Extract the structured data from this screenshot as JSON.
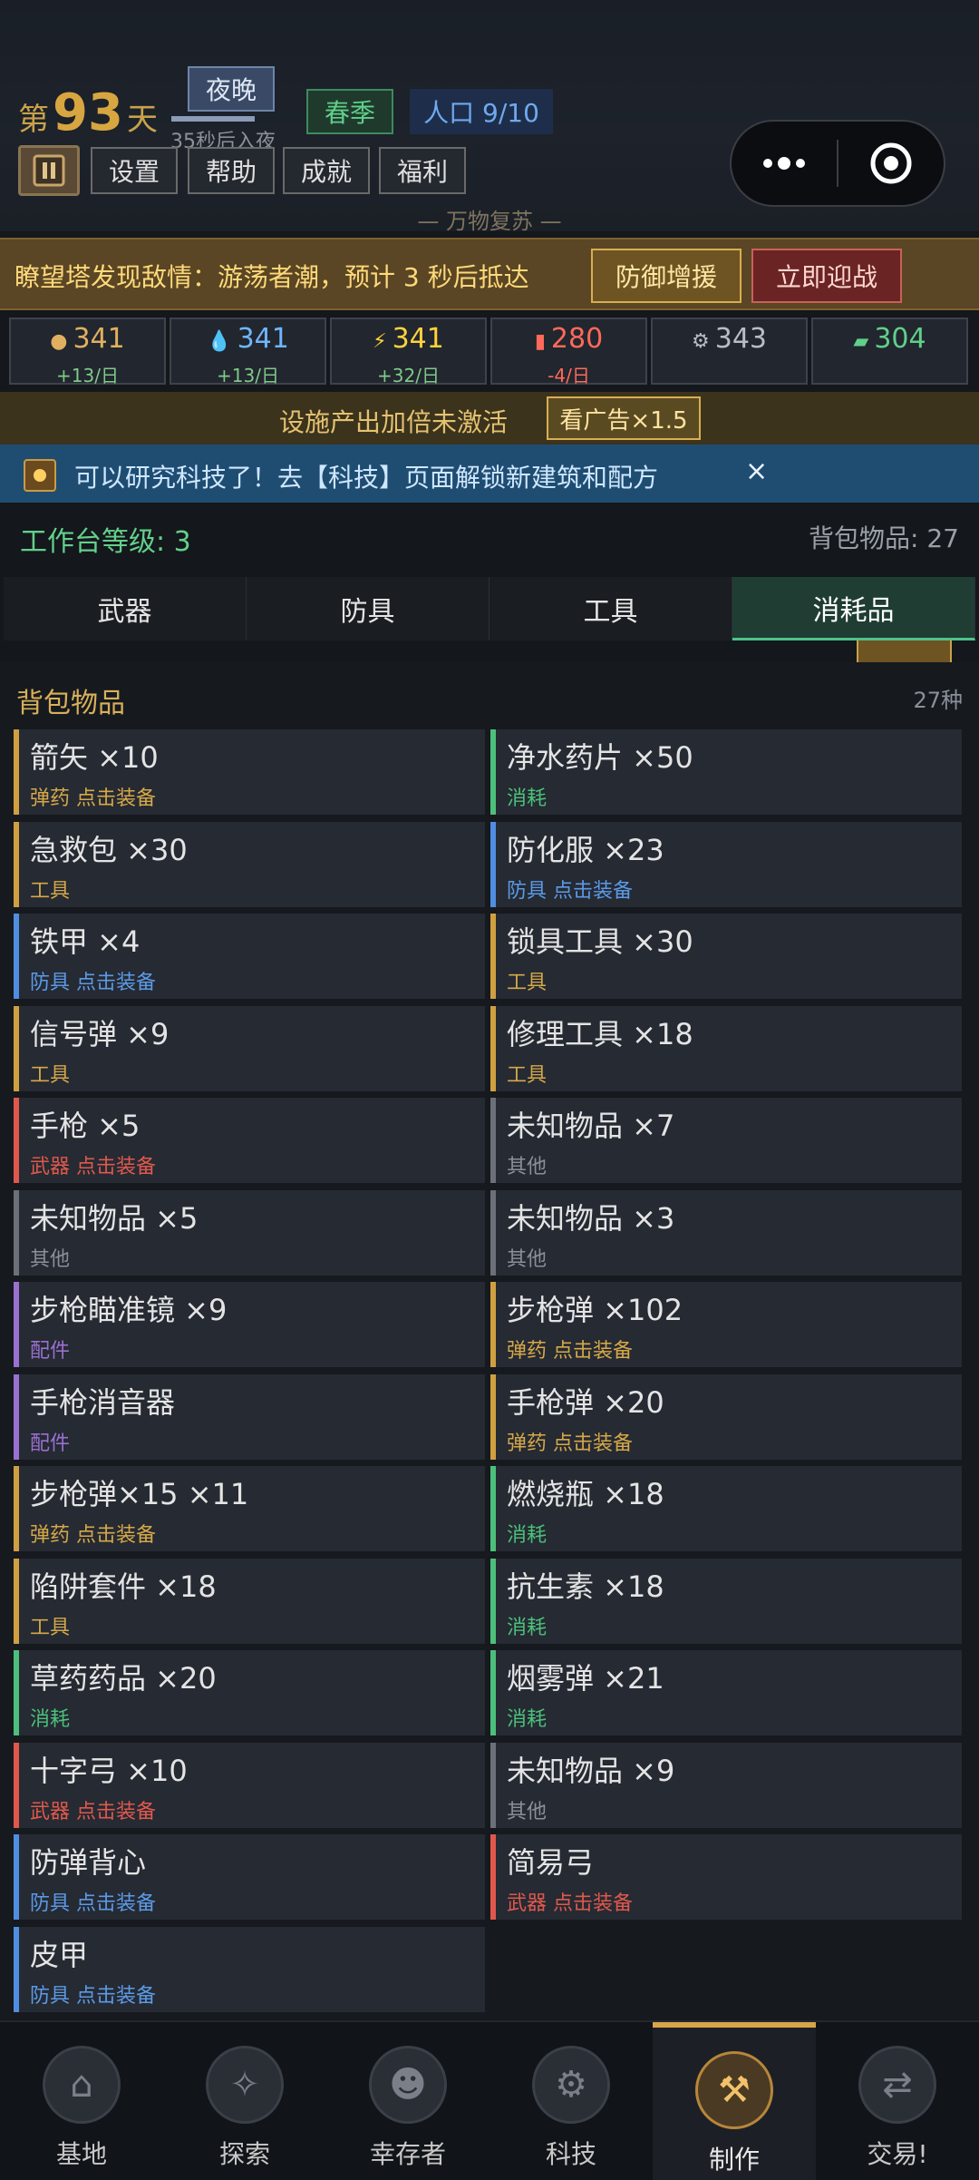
{
  "header": {
    "day_prefix": "第",
    "day_number": "93",
    "day_suffix": "天",
    "phase": "夜晚",
    "phase_sub": "35秒后入夜",
    "phase_progress": 0.75,
    "season": "春季",
    "population": "人口 9/10",
    "menu_buttons": [
      "设置",
      "帮助",
      "成就",
      "福利"
    ],
    "motto": "— 万物复苏 —"
  },
  "alert": {
    "text": "瞭望塔发现敌情：游荡者潮，预计 3 秒后抵达",
    "defend_label": "防御增援",
    "fight_label": "立即迎战"
  },
  "resources": [
    {
      "value": "341",
      "rate": "+13/日",
      "icon": "food-icon",
      "color": "#e0b060",
      "rate_color": "#7fc98a"
    },
    {
      "value": "341",
      "rate": "+13/日",
      "icon": "water-icon",
      "color": "#6fb6ff",
      "rate_color": "#7fc98a"
    },
    {
      "value": "341",
      "rate": "+32/日",
      "icon": "energy-icon",
      "color": "#ffd23c",
      "rate_color": "#7fc98a"
    },
    {
      "value": "280",
      "rate": "-4/日",
      "icon": "fuel-icon",
      "color": "#ff6a5a",
      "rate_color": "#ff6a5a"
    },
    {
      "value": "343",
      "rate": "",
      "icon": "parts-icon",
      "color": "#b8bcc4",
      "rate_color": "#7fc98a"
    },
    {
      "value": "304",
      "rate": "",
      "icon": "medicine-icon",
      "color": "#5fd08a",
      "rate_color": "#7fc98a"
    }
  ],
  "ad": {
    "text": "设施产出加倍未激活",
    "button": "看广告×1.5"
  },
  "tech_banner": {
    "text": "可以研究科技了！去【科技】页面解锁新建筑和配方",
    "close": "×"
  },
  "bench": {
    "level_text": "工作台等级: 3",
    "bag_text": "背包物品: 27"
  },
  "tabs": [
    "武器",
    "防具",
    "工具",
    "消耗品"
  ],
  "active_tab": 3,
  "backpack": {
    "title": "背包物品",
    "count": "27种",
    "items": [
      {
        "name": "箭矢 ×10",
        "sub": "弹药 点击装备",
        "type": "ammo"
      },
      {
        "name": "净水药片 ×50",
        "sub": "消耗",
        "type": "consumable"
      },
      {
        "name": "急救包 ×30",
        "sub": "工具",
        "type": "tool"
      },
      {
        "name": "防化服 ×23",
        "sub": "防具 点击装备",
        "type": "armor"
      },
      {
        "name": "铁甲 ×4",
        "sub": "防具 点击装备",
        "type": "armor"
      },
      {
        "name": "锁具工具 ×30",
        "sub": "工具",
        "type": "tool"
      },
      {
        "name": "信号弹 ×9",
        "sub": "工具",
        "type": "tool"
      },
      {
        "name": "修理工具 ×18",
        "sub": "工具",
        "type": "tool"
      },
      {
        "name": "手枪 ×5",
        "sub": "武器 点击装备",
        "type": "weapon"
      },
      {
        "name": "未知物品 ×7",
        "sub": "其他",
        "type": "other"
      },
      {
        "name": "未知物品 ×5",
        "sub": "其他",
        "type": "other"
      },
      {
        "name": "未知物品 ×3",
        "sub": "其他",
        "type": "other"
      },
      {
        "name": "步枪瞄准镜 ×9",
        "sub": "配件",
        "type": "attachment"
      },
      {
        "name": "步枪弹 ×102",
        "sub": "弹药 点击装备",
        "type": "ammo"
      },
      {
        "name": "手枪消音器",
        "sub": "配件",
        "type": "attachment"
      },
      {
        "name": "手枪弹 ×20",
        "sub": "弹药 点击装备",
        "type": "ammo"
      },
      {
        "name": "步枪弹×15 ×11",
        "sub": "弹药 点击装备",
        "type": "ammo"
      },
      {
        "name": "燃烧瓶 ×18",
        "sub": "消耗",
        "type": "consumable"
      },
      {
        "name": "陷阱套件 ×18",
        "sub": "工具",
        "type": "tool"
      },
      {
        "name": "抗生素 ×18",
        "sub": "消耗",
        "type": "consumable"
      },
      {
        "name": "草药药品 ×20",
        "sub": "消耗",
        "type": "consumable"
      },
      {
        "name": "烟雾弹 ×21",
        "sub": "消耗",
        "type": "consumable"
      },
      {
        "name": "十字弓 ×10",
        "sub": "武器 点击装备",
        "type": "weapon"
      },
      {
        "name": "未知物品 ×9",
        "sub": "其他",
        "type": "other"
      },
      {
        "name": "防弹背心",
        "sub": "防具 点击装备",
        "type": "armor"
      },
      {
        "name": "简易弓",
        "sub": "武器 点击装备",
        "type": "weapon"
      },
      {
        "name": "皮甲",
        "sub": "防具 点击装备",
        "type": "armor"
      }
    ]
  },
  "type_colors": {
    "ammo": "#d0a040",
    "consumable": "#4cc07a",
    "tool": "#d0a040",
    "armor": "#4f8ee0",
    "weapon": "#e0584c",
    "other": "#6c7078",
    "attachment": "#9a70d0"
  },
  "sub_colors": {
    "ammo": "#d6a848",
    "consumable": "#4cc07a",
    "tool": "#d6a848",
    "armor": "#5c9ae6",
    "weapon": "#e0584c",
    "other": "#8a8f98",
    "attachment": "#9a70d0"
  },
  "nav": [
    {
      "label": "基地",
      "icon": "base-icon"
    },
    {
      "label": "探索",
      "icon": "compass-icon"
    },
    {
      "label": "幸存者",
      "icon": "survivors-icon"
    },
    {
      "label": "科技",
      "icon": "tech-gear-icon"
    },
    {
      "label": "制作",
      "icon": "crafting-icon"
    },
    {
      "label": "交易!",
      "icon": "trade-icon"
    }
  ],
  "active_nav": 4
}
